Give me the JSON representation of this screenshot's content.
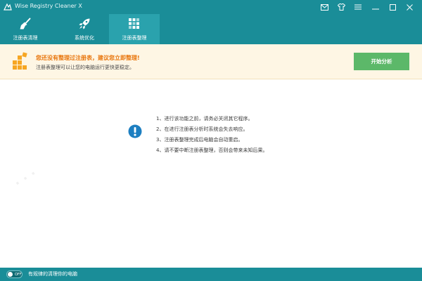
{
  "app": {
    "title": "Wise Registry Cleaner X"
  },
  "window_controls": {
    "icons": [
      "mail-icon",
      "shirt-icon",
      "menu-icon",
      "minimize-icon",
      "maximize-icon",
      "close-icon"
    ]
  },
  "tabs": [
    {
      "label": "注册表清理",
      "icon": "broom-icon",
      "active": false
    },
    {
      "label": "系统优化",
      "icon": "rocket-icon",
      "active": false
    },
    {
      "label": "注册表整理",
      "icon": "blocks-icon",
      "active": true
    }
  ],
  "banner": {
    "title": "您还没有整理过注册表，建议您立即整理!",
    "subtitle": "注册表整理可以让您的电脑运行更快更稳定。",
    "button_label": "开始分析"
  },
  "notes": [
    "1、进行该功能之前，请务必关闭其它程序。",
    "2、在进行注册表分析时系统会失去响应。",
    "3、注册表整理完成后电脑会自动重启。",
    "4、请不要中断注册表整理，否则会带来未知后果。"
  ],
  "statusbar": {
    "toggle_label": "OFF",
    "text": "有规律的清理你的电脑"
  },
  "colors": {
    "header": "#1a8d98",
    "active_tab": "#2aa2ad",
    "banner_bg": "#fef6e4",
    "banner_title": "#e8750c",
    "button": "#5cb869",
    "info_icon": "#1d7fc1"
  }
}
